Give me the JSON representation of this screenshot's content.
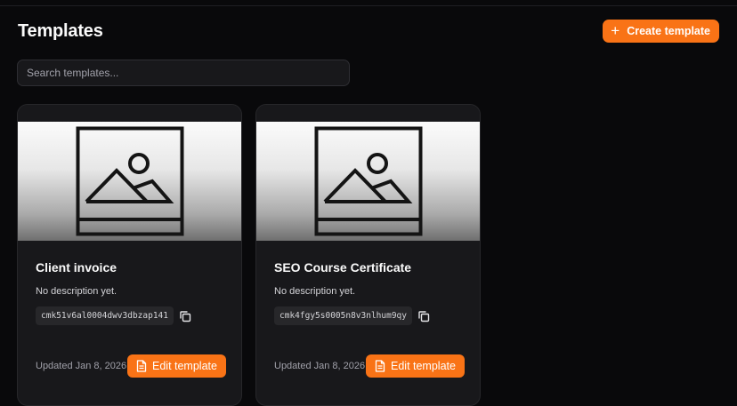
{
  "header": {
    "title": "Templates",
    "create_label": "Create template"
  },
  "search": {
    "placeholder": "Search templates..."
  },
  "templates": [
    {
      "title": "Client invoice",
      "description": "No description yet.",
      "id": "cmk51v6al0004dwv3dbzap141",
      "updated": "Updated Jan 8, 2026",
      "edit_label": "Edit template"
    },
    {
      "title": "SEO Course Certificate",
      "description": "No description yet.",
      "id": "cmk4fgy5s0005n8v3nlhum9qy",
      "updated": "Updated Jan 8, 2026",
      "edit_label": "Edit template"
    }
  ],
  "icons": {
    "create": "plus-icon",
    "thumbnail": "image-placeholder-icon",
    "copy": "copy-icon",
    "edit": "document-icon"
  },
  "colors": {
    "accent": "#f97316",
    "background": "#09090b",
    "card": "#18181b"
  }
}
